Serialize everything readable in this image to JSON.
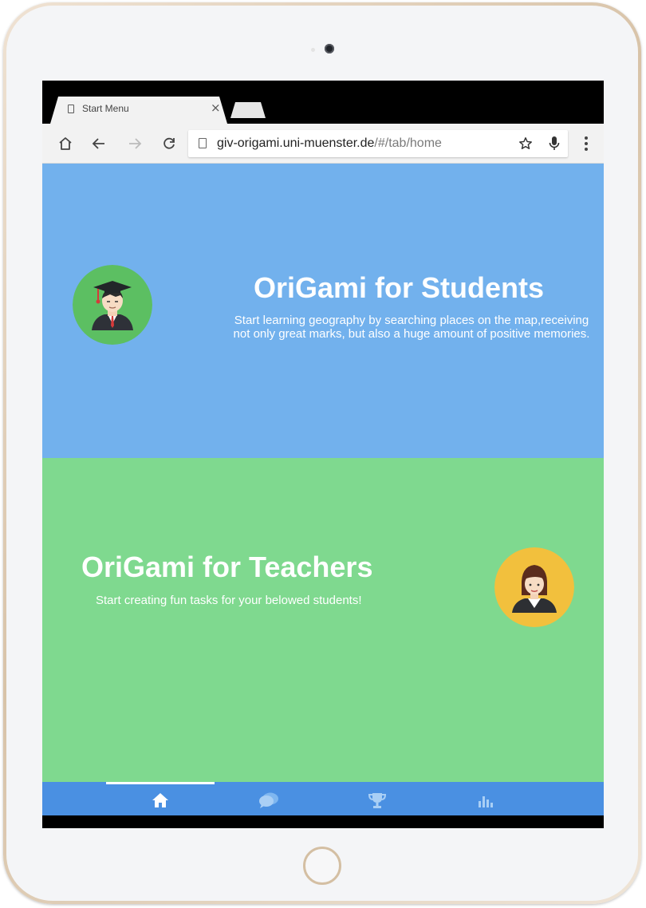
{
  "browser": {
    "tab_title": "Start Menu",
    "tab_close": "×",
    "url_host": "giv-origami.uni-muenster.de",
    "url_path": "/#/tab/home"
  },
  "students": {
    "title": "OriGami for Students",
    "description_line1": "Start learning geography by searching places on the map,receiving",
    "description_line2": "not only great marks, but also a huge amount of positive memories."
  },
  "teachers": {
    "title": "OriGami for Teachers",
    "description": "Start creating fun tasks for your belowed students!"
  },
  "bottom_nav": {
    "items": [
      "home-icon",
      "chat-icon",
      "trophy-icon",
      "bar-chart-icon"
    ],
    "active_index": 0
  },
  "colors": {
    "students_bg": "#72b1ed",
    "teachers_bg": "#7fd98f",
    "nav_bg": "#4a90e2",
    "student_avatar_bg": "#5cbf62",
    "teacher_avatar_bg": "#f2c03d"
  }
}
